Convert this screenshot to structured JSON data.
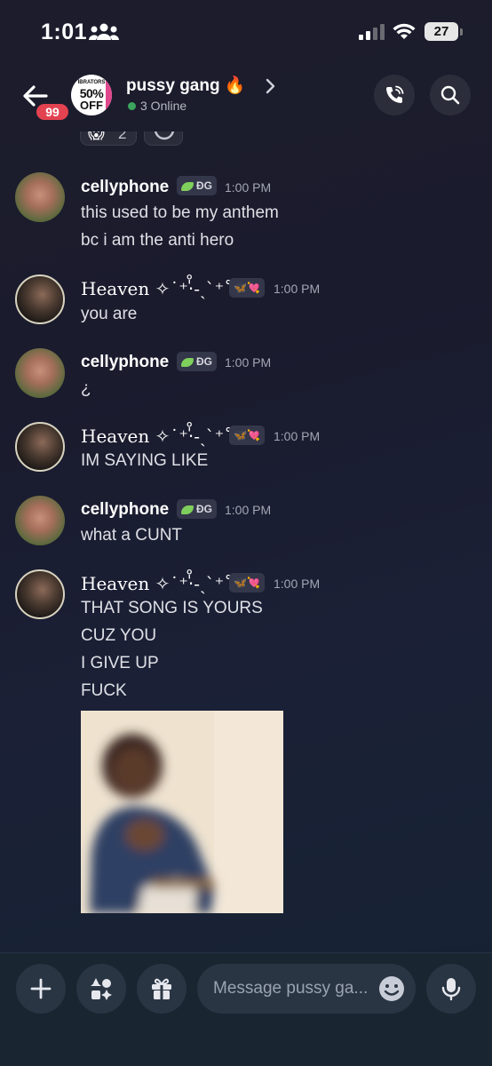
{
  "status_bar": {
    "time": "1:01",
    "battery": "27"
  },
  "header": {
    "unread_count": "99",
    "group_avatar": {
      "line1": "IBRATORS",
      "line2": "50%",
      "line3": "OFF"
    },
    "channel_name": "pussy gang 🔥",
    "online_status": "3 Online"
  },
  "top_reactions": [
    {
      "emoji": "😱",
      "count": "2"
    }
  ],
  "messages": [
    {
      "author": "cellyphone",
      "tag": "ƉG",
      "time": "1:00 PM",
      "lines": [
        "this used to be my anthem",
        "bc i am the anti hero"
      ]
    },
    {
      "author": "Heaven ✧˙⁺‧̍̊-ˏˋ⁺˚",
      "tag": "🦋💘",
      "time": "1:00 PM",
      "lines": [
        "you are"
      ]
    },
    {
      "author": "cellyphone",
      "tag": "ƉG",
      "time": "1:00 PM",
      "lines": [
        "¿"
      ]
    },
    {
      "author": "Heaven ✧˙⁺‧̍̊-ˏˋ⁺˚",
      "tag": "🦋💘",
      "time": "1:00 PM",
      "lines": [
        "IM SAYING LIKE"
      ]
    },
    {
      "author": "cellyphone",
      "tag": "ƉG",
      "time": "1:00 PM",
      "lines": [
        "what a CUNT"
      ]
    },
    {
      "author": "Heaven ✧˙⁺‧̍̊-ˏˋ⁺˚",
      "tag": "🦋💘",
      "time": "1:00 PM",
      "lines": [
        "THAT SONG IS YOURS",
        "CUZ YOU",
        "I GIVE UP",
        "FUCK"
      ]
    }
  ],
  "composer": {
    "placeholder": "Message pussy ga..."
  },
  "colors": {
    "accent_online": "#3ba55d",
    "badge": "#e34250",
    "background": "#1c1c2c"
  }
}
